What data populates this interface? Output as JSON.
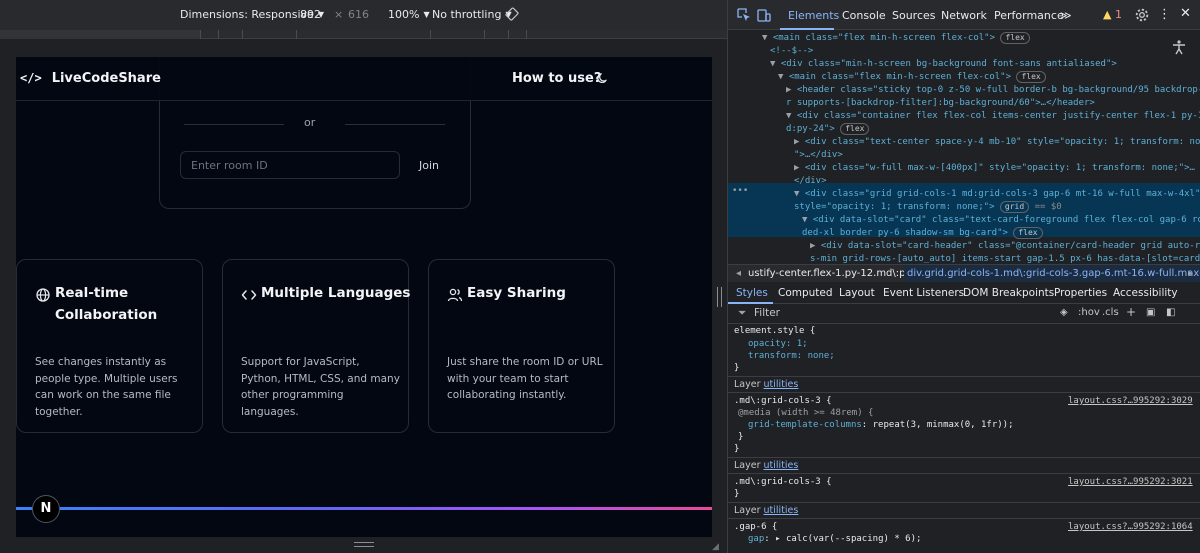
{
  "device_toolbar": {
    "dimensions_label": "Dimensions: Responsive",
    "width": "892",
    "times": "×",
    "height": "616",
    "zoom": "100%",
    "throttling": "No throttling"
  },
  "site": {
    "logo_glyph": "</>",
    "logo_text": "LiveCodeShare",
    "how_to_use": "How to use?",
    "or_text": "or",
    "room_placeholder": "Enter room ID",
    "join_label": "Join",
    "features": [
      {
        "icon": "globe-icon",
        "title": "Real-time Collaboration",
        "description": "See changes instantly as people type. Multiple users can work on the same file together."
      },
      {
        "icon": "code-icon",
        "title": "Multiple Languages",
        "description": "Support for JavaScript, Python, HTML, CSS, and many other programming languages."
      },
      {
        "icon": "users-icon",
        "title": "Easy Sharing",
        "description": "Just share the room ID or URL with your team to start collaborating instantly."
      }
    ],
    "badge_letter": "N"
  },
  "devtools": {
    "tabs": [
      "Elements",
      "Console",
      "Sources",
      "Network",
      "Performance"
    ],
    "more": "≫",
    "warn_count": "1",
    "dom_lines": [
      {
        "indent": 0,
        "tri": "▼",
        "html": "<main class=\"flex min-h-screen flex-col\">",
        "pill": "flex"
      },
      {
        "indent": 1,
        "tri": "",
        "html": "<!--$-->",
        "pill": ""
      },
      {
        "indent": 1,
        "tri": "▼",
        "html": "<div class=\"min-h-screen bg-background font-sans antialiased\">",
        "pill": ""
      },
      {
        "indent": 2,
        "tri": "▼",
        "html": "<main class=\"flex min-h-screen flex-col\">",
        "pill": "flex"
      },
      {
        "indent": 3,
        "tri": "▶",
        "html": "<header class=\"sticky top-0 z-50 w-full border-b bg-background/95 backdrop-blu",
        "pill": ""
      },
      {
        "indent": 3,
        "tri": "",
        "html": "r supports-[backdrop-filter]:bg-background/60\">…</header>",
        "pill": ""
      },
      {
        "indent": 3,
        "tri": "▼",
        "html": "<div class=\"container flex flex-col items-center justify-center flex-1 py-12 m",
        "pill": ""
      },
      {
        "indent": 3,
        "tri": "",
        "html": "d:py-24\">",
        "pill": "flex"
      },
      {
        "indent": 4,
        "tri": "▶",
        "html": "<div class=\"text-center space-y-4 mb-10\" style=\"opacity: 1; transform: none;",
        "pill": ""
      },
      {
        "indent": 4,
        "tri": "",
        "html": "\">…</div>",
        "pill": ""
      },
      {
        "indent": 4,
        "tri": "▶",
        "html": "<div class=\"w-full max-w-[400px]\" style=\"opacity: 1; transform: none;\">…",
        "pill": ""
      },
      {
        "indent": 4,
        "tri": "",
        "html": "</div>",
        "pill": ""
      },
      {
        "indent": 4,
        "tri": "▼",
        "html": "<div class=\"grid grid-cols-1 md:grid-cols-3 gap-6 mt-16 w-full max-w-4xl\"",
        "pill": ""
      },
      {
        "indent": 4,
        "tri": "",
        "html": "style=\"opacity: 1; transform: none;\">",
        "pill": "grid"
      },
      {
        "indent": 5,
        "tri": "▼",
        "html": "<div data-slot=\"card\" class=\"text-card-foreground flex flex-col gap-6 roun",
        "pill": ""
      },
      {
        "indent": 5,
        "tri": "",
        "html": "ded-xl border py-6 shadow-sm bg-card\">",
        "pill": "flex"
      },
      {
        "indent": 6,
        "tri": "▶",
        "html": "<div data-slot=\"card-header\" class=\"@container/card-header grid auto-row",
        "pill": ""
      },
      {
        "indent": 6,
        "tri": "",
        "html": "s-min grid-rows-[auto_auto] items-start gap-1.5 px-6 has-data-[slot=card",
        "pill": ""
      }
    ],
    "selected_suffix": "== $0",
    "breadcrumb_left": "ustify-center.flex-1.py-12.md\\:py-24",
    "breadcrumb_active": "div.grid.grid-cols-1.md\\:grid-cols-3.gap-6.mt-16.w-full.max-w-4xl",
    "sub_tabs": [
      "Styles",
      "Computed",
      "Layout",
      "Event Listeners",
      "DOM Breakpoints",
      "Properties",
      "Accessibility"
    ],
    "filter_placeholder": "Filter",
    "filter_controls": [
      ":hov",
      ".cls",
      "+"
    ],
    "styles": {
      "element_style": "element.style {",
      "opacity": "opacity: 1;",
      "transform": "transform: none;",
      "layer_label": "Layer",
      "layer_link": "utilities",
      "rule1_selector": ".md\\:grid-cols-3 {",
      "rule1_media": "@media (width >= 48rem) {",
      "rule1_prop": "grid-template-columns",
      "rule1_value": "repeat(3, minmax(0, 1fr));",
      "rule1_src": "layout.css?…995292:3029",
      "rule2_selector": ".md\\:grid-cols-3 {",
      "rule2_src": "layout.css?…995292:3021",
      "rule3_selector": ".gap-6 {",
      "rule3_src": "layout.css?…995292:1064",
      "rule3_prop": "gap",
      "rule3_value": "calc(var(--spacing) * 6);"
    }
  },
  "colors": {
    "page_bg": "#030712",
    "accent": "#8ab4f8",
    "gradient_start": "#3b82f6",
    "gradient_end": "#ec4899"
  }
}
